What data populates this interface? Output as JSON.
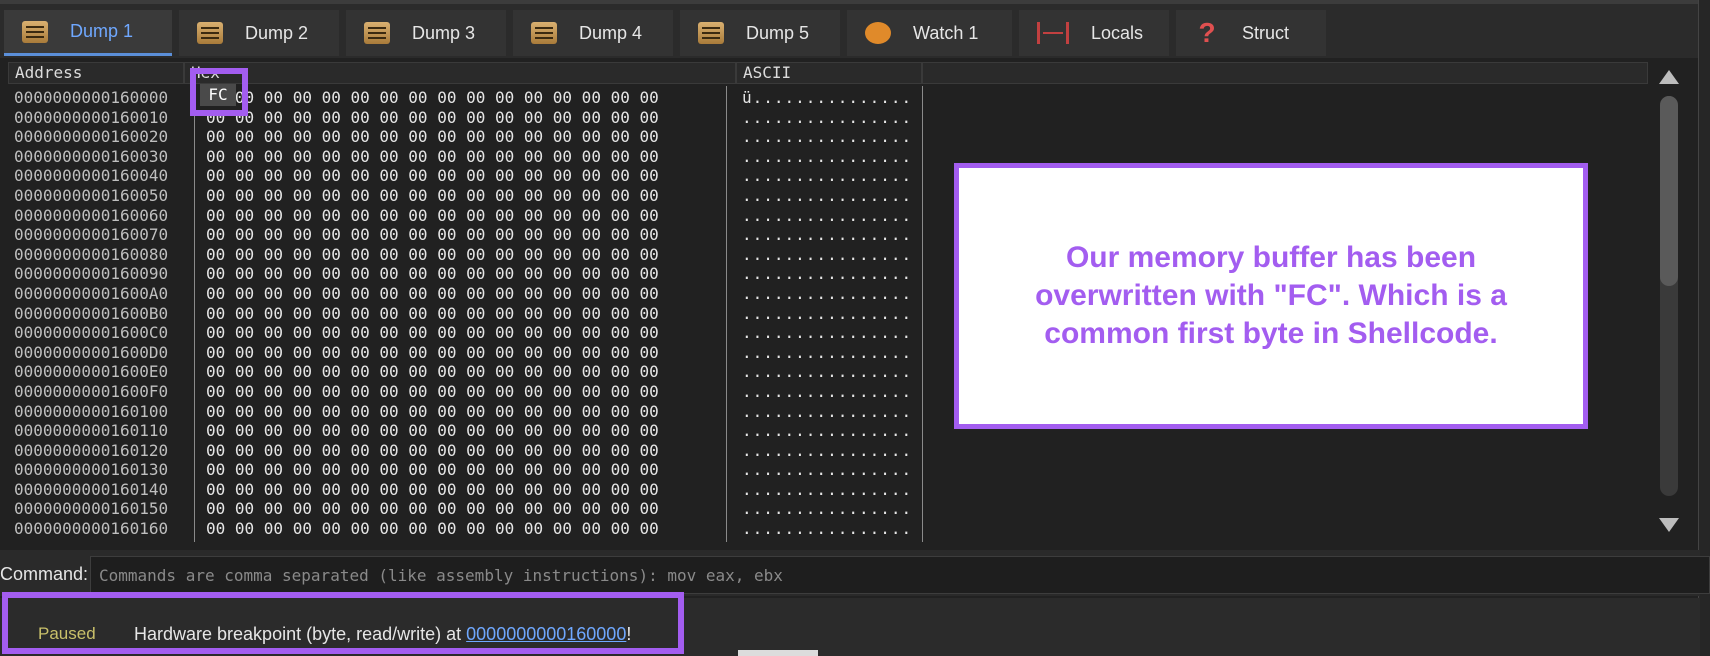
{
  "tabs": [
    {
      "label": "Dump 1",
      "icon": "dump-icon",
      "active": true
    },
    {
      "label": "Dump 2",
      "icon": "dump-icon",
      "active": false
    },
    {
      "label": "Dump 3",
      "icon": "dump-icon",
      "active": false
    },
    {
      "label": "Dump 4",
      "icon": "dump-icon",
      "active": false
    },
    {
      "label": "Dump 5",
      "icon": "dump-icon",
      "active": false
    },
    {
      "label": "Watch 1",
      "icon": "watch-icon",
      "active": false
    },
    {
      "label": "Locals",
      "icon": "locals-icon",
      "active": false
    },
    {
      "label": "Struct",
      "icon": "struct-icon",
      "active": false
    }
  ],
  "dump": {
    "headers": {
      "address": "Address",
      "hex": "Hex",
      "ascii": "ASCII"
    },
    "addresses": [
      "0000000000160000",
      "0000000000160010",
      "0000000000160020",
      "0000000000160030",
      "0000000000160040",
      "0000000000160050",
      "0000000000160060",
      "0000000000160070",
      "0000000000160080",
      "0000000000160090",
      "00000000001600A0",
      "00000000001600B0",
      "00000000001600C0",
      "00000000001600D0",
      "00000000001600E0",
      "00000000001600F0",
      "0000000000160100",
      "0000000000160110",
      "0000000000160120",
      "0000000000160130",
      "0000000000160140",
      "0000000000160150",
      "0000000000160160"
    ],
    "first_row_hex": "FC 00 00 00 00 00 00 00 00 00 00 00 00 00 00 00",
    "zero_row_hex": "00 00 00 00 00 00 00 00 00 00 00 00 00 00 00 00",
    "first_row_ascii": "ü...............",
    "zero_row_ascii": "................",
    "highlighted_byte": "FC"
  },
  "annotation": {
    "text": "Our memory buffer has been overwritten with \"FC\". Which is a common first byte in Shellcode.",
    "color": "#a35df0"
  },
  "command": {
    "label": "Command:",
    "placeholder": "Commands are comma separated (like assembly instructions): mov eax, ebx"
  },
  "status": {
    "state": "Paused",
    "message_prefix": "Hardware breakpoint (byte, read/write) at ",
    "address_link": "0000000000160000",
    "message_suffix": "!"
  }
}
